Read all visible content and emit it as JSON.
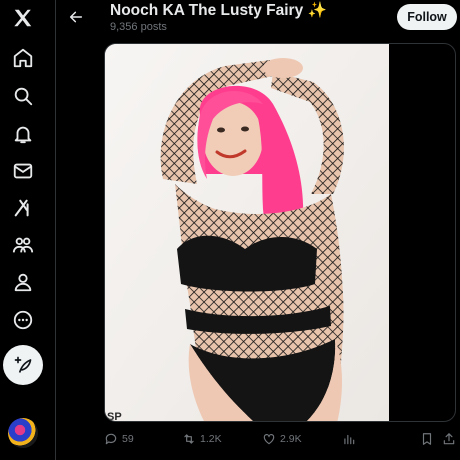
{
  "header": {
    "title": "Nooch KA The Lusty Fairy ✨",
    "post_count": "9,356 posts",
    "follow_label": "Follow"
  },
  "nav": {
    "items": [
      "x-logo",
      "home",
      "explore",
      "notifications",
      "messages",
      "grok",
      "communities",
      "profile",
      "more",
      "post"
    ]
  },
  "media": {
    "watermark": "SP"
  },
  "actions": {
    "replies": "59",
    "reposts": "1.2K",
    "likes": "2.9K"
  },
  "colors": {
    "background": "#000000",
    "text": "#e7e9ea",
    "muted": "#71767b",
    "button": "#eff3f4",
    "hair": "#ff3d8e"
  }
}
